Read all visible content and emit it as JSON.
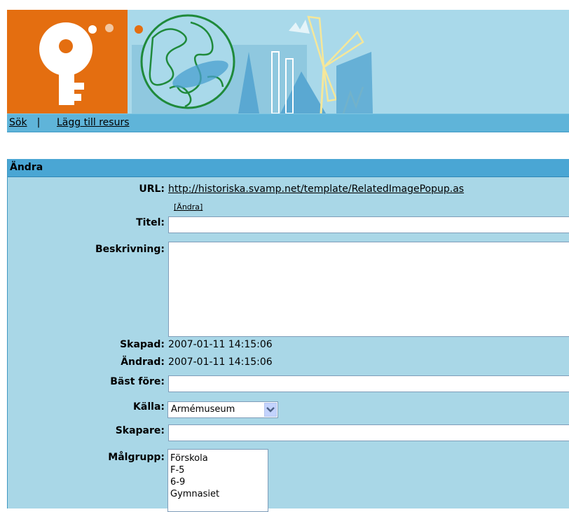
{
  "nav": {
    "search_label": "Sök",
    "separator": "|",
    "add_resource_label": "Lägg till resurs"
  },
  "panel": {
    "title": "Ändra"
  },
  "form": {
    "url_label": "URL:",
    "url_value": "http://historiska.svamp.net/template/RelatedImagePopup.as",
    "change_link": "[Ändra]",
    "title_label": "Titel:",
    "title_value": "",
    "description_label": "Beskrivning:",
    "description_value": "",
    "created_label": "Skapad:",
    "created_value": "2007-01-11 14:15:06",
    "modified_label": "Ändrad:",
    "modified_value": "2007-01-11 14:15:06",
    "best_before_label": "Bäst före:",
    "best_before_value": "",
    "source_label": "Källa:",
    "source_selected": "Armémuseum",
    "creator_label": "Skapare:",
    "creator_value": "",
    "audience_label": "Målgrupp:",
    "audience_options": [
      "Förskola",
      "F-5",
      "6-9",
      "Gymnasiet"
    ]
  },
  "colors": {
    "banner_bg": "#a9d9ea",
    "logo_orange": "#e46e10",
    "navbar": "#5fb4d9",
    "panel_header": "#4aa6d4",
    "panel_bg": "#a9d7e7"
  },
  "icons": [
    "key-logo-icon",
    "globe-icon",
    "windmill-icon",
    "dropdown-arrow-icon"
  ]
}
